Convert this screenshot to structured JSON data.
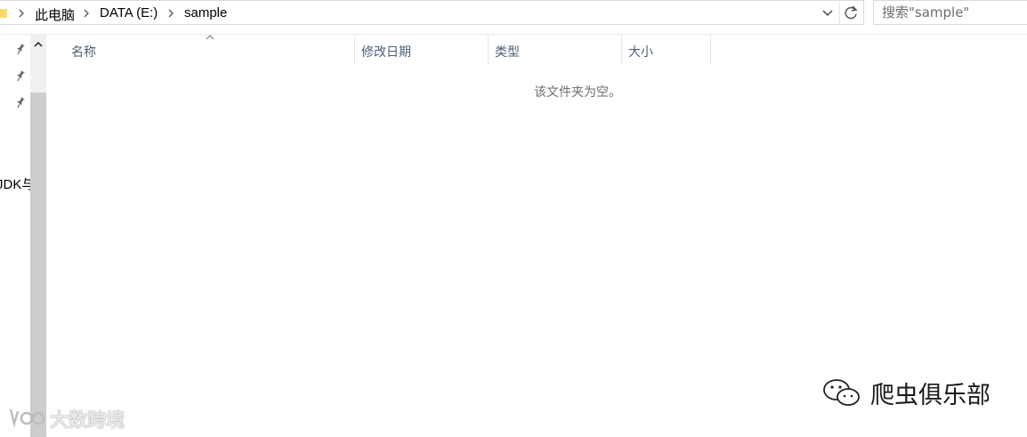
{
  "address_bar": {
    "breadcrumbs": [
      "此电脑",
      "DATA (E:)",
      "sample"
    ]
  },
  "search": {
    "placeholder": "搜索\"sample\""
  },
  "nav": {
    "partial_item": "JDK与"
  },
  "columns": [
    {
      "label": "名称"
    },
    {
      "label": "修改日期"
    },
    {
      "label": "类型"
    },
    {
      "label": "大小"
    }
  ],
  "sort": {
    "column": "名称",
    "direction": "ascending"
  },
  "content": {
    "empty_message": "该文件夹为空。"
  },
  "watermarks": {
    "left": "大数跨境",
    "right": "爬虫俱乐部"
  },
  "icons": {
    "folder": "folder-icon",
    "chevron": "chevron-right-icon",
    "dropdown": "chevron-down-icon",
    "refresh": "refresh-icon",
    "pin": "pin-icon",
    "scroll_up": "scroll-up-arrow-icon",
    "sort": "sort-ascending-icon"
  }
}
